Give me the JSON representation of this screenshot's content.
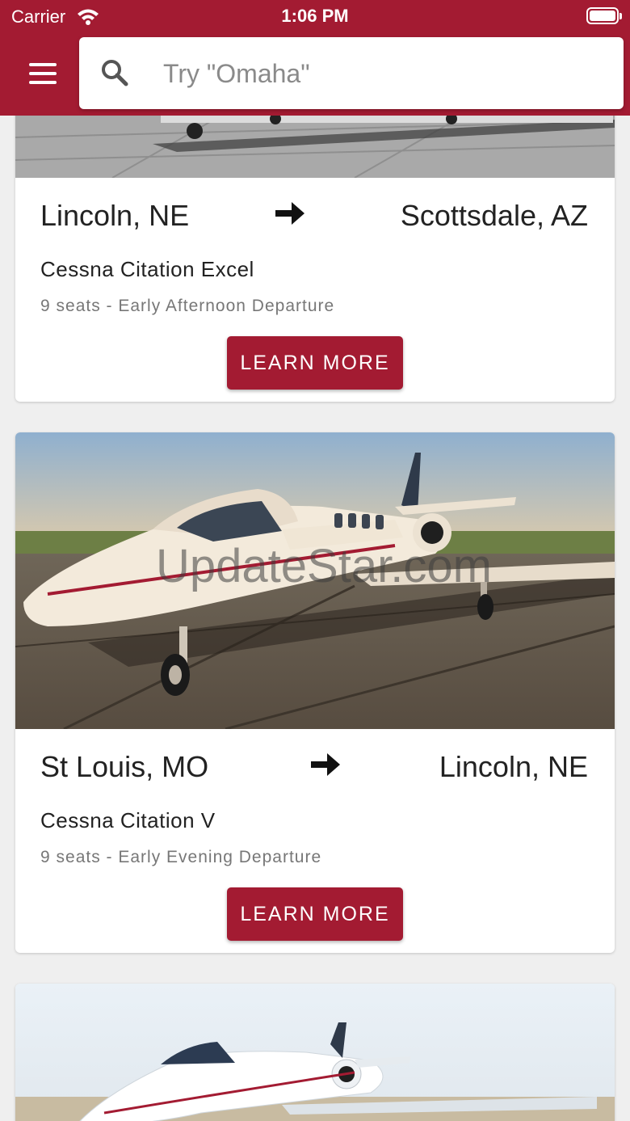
{
  "status_bar": {
    "carrier": "Carrier",
    "time": "1:06 PM"
  },
  "search": {
    "placeholder": "Try \"Omaha\""
  },
  "flights": [
    {
      "from": "Lincoln, NE",
      "to": "Scottsdale, AZ",
      "aircraft": "Cessna Citation Excel",
      "details": "9 seats - Early Afternoon Departure",
      "button_label": "LEARN MORE"
    },
    {
      "from": "St Louis, MO",
      "to": "Lincoln, NE",
      "aircraft": "Cessna Citation V",
      "details": "9 seats - Early Evening Departure",
      "button_label": "LEARN MORE",
      "watermark": "UpdateStar.com"
    }
  ],
  "colors": {
    "brand": "#a31b32",
    "background": "#efefef"
  },
  "icons": {
    "menu": "hamburger-icon",
    "search": "search-icon",
    "route": "arrow-right-icon",
    "wifi": "wifi-icon",
    "battery": "battery-icon"
  }
}
